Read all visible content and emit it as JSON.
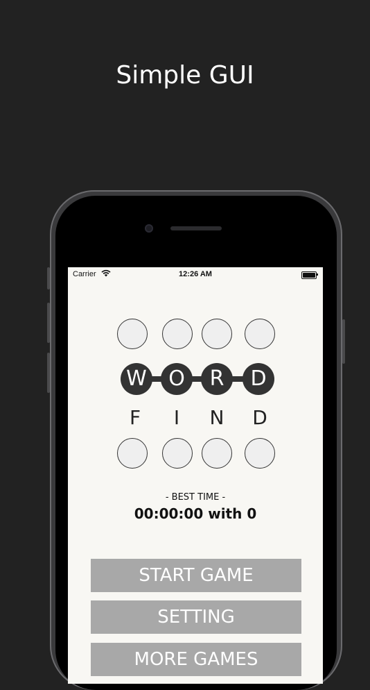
{
  "headline": "Simple GUI",
  "status_bar": {
    "carrier": "Carrier",
    "time": "12:26 AM"
  },
  "logo": {
    "word_letters": [
      "W",
      "O",
      "R",
      "D"
    ],
    "find_letters": [
      "F",
      "I",
      "N",
      "D"
    ]
  },
  "best_time": {
    "label": "- BEST TIME -",
    "value": "00:00:00 with 0"
  },
  "buttons": {
    "start": "START GAME",
    "setting": "SETTING",
    "more": "MORE GAMES"
  },
  "icons": [
    "wifi-icon",
    "battery-icon"
  ]
}
